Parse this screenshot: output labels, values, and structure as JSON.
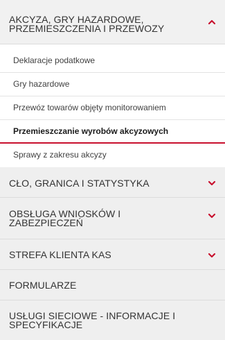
{
  "accent_color": "#c8102e",
  "sections": [
    {
      "title_lines": [
        "AKCYZA, GRY HAZARDOWE,",
        "PRZEMIESZCZENIA I PRZEWOZY"
      ],
      "icon": "chevron-up-icon",
      "expanded": true,
      "items": [
        {
          "label": "Deklaracje podatkowe",
          "active": false
        },
        {
          "label": "Gry hazardowe",
          "active": false
        },
        {
          "label": "Przewóz towarów objęty monitorowaniem",
          "active": false
        },
        {
          "label": "Przemieszczanie wyrobów akcyzowych",
          "active": true
        },
        {
          "label": "Sprawy z zakresu akcyzy",
          "active": false
        }
      ]
    },
    {
      "title_lines": [
        "CŁO, GRANICA I STATYSTYKA"
      ],
      "icon": "chevron-down-icon",
      "expanded": false
    },
    {
      "title_lines": [
        "OBSŁUGA WNIOSKÓW I",
        "ZABEZPIECZEŃ"
      ],
      "icon": "chevron-down-icon",
      "expanded": false
    },
    {
      "title_lines": [
        "STREFA KLIENTA KAS"
      ],
      "icon": "chevron-down-icon",
      "expanded": false
    },
    {
      "title_lines": [
        "FORMULARZE"
      ],
      "icon": null,
      "expanded": false
    },
    {
      "title_lines": [
        "USŁUGI SIECIOWE - INFORMACJE I",
        "SPECYFIKACJE"
      ],
      "icon": null,
      "expanded": false
    }
  ]
}
